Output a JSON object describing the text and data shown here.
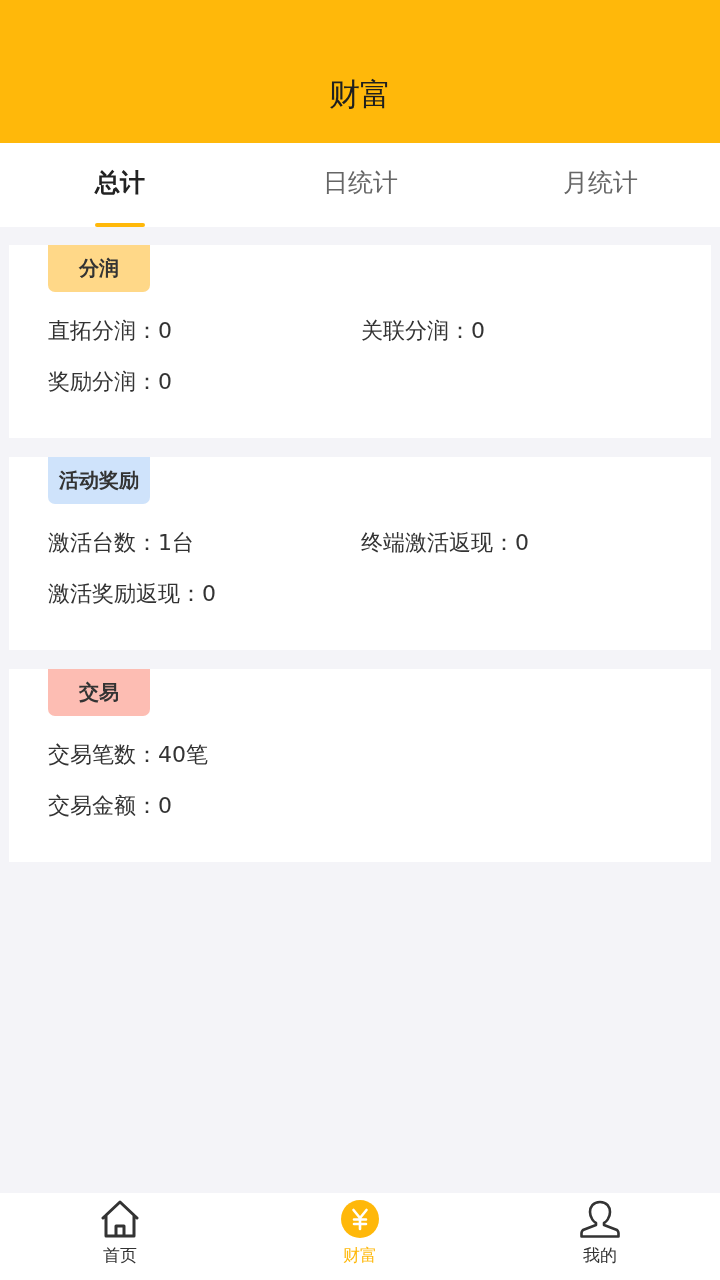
{
  "header": {
    "title": "财富"
  },
  "tabs": [
    {
      "label": "总计",
      "selected": true
    },
    {
      "label": "日统计",
      "selected": false
    },
    {
      "label": "月统计",
      "selected": false
    }
  ],
  "sections": [
    {
      "tag": "分润",
      "color": "#ffd888",
      "rows": [
        [
          {
            "label": "直拓分润：",
            "value": "0"
          },
          {
            "label": "关联分润：",
            "value": "0"
          }
        ],
        [
          {
            "label": "奖励分润：",
            "value": "0"
          }
        ]
      ]
    },
    {
      "tag": "活动奖励",
      "color": "#cfe3fb",
      "rows": [
        [
          {
            "label": "激活台数：",
            "value": "1台"
          },
          {
            "label": "终端激活返现：",
            "value": "0"
          }
        ],
        [
          {
            "label": "激活奖励返现：",
            "value": "0"
          }
        ]
      ]
    },
    {
      "tag": "交易",
      "color": "#fdbdb3",
      "rows": [
        [
          {
            "label": "交易笔数：",
            "value": "40笔"
          }
        ],
        [
          {
            "label": "交易金额：",
            "value": "0"
          }
        ]
      ]
    }
  ],
  "bottom_nav": [
    {
      "kind": "home",
      "label": "首页",
      "selected": false
    },
    {
      "kind": "wealth",
      "label": "财富",
      "selected": true
    },
    {
      "kind": "profile",
      "label": "我的",
      "selected": false
    }
  ]
}
